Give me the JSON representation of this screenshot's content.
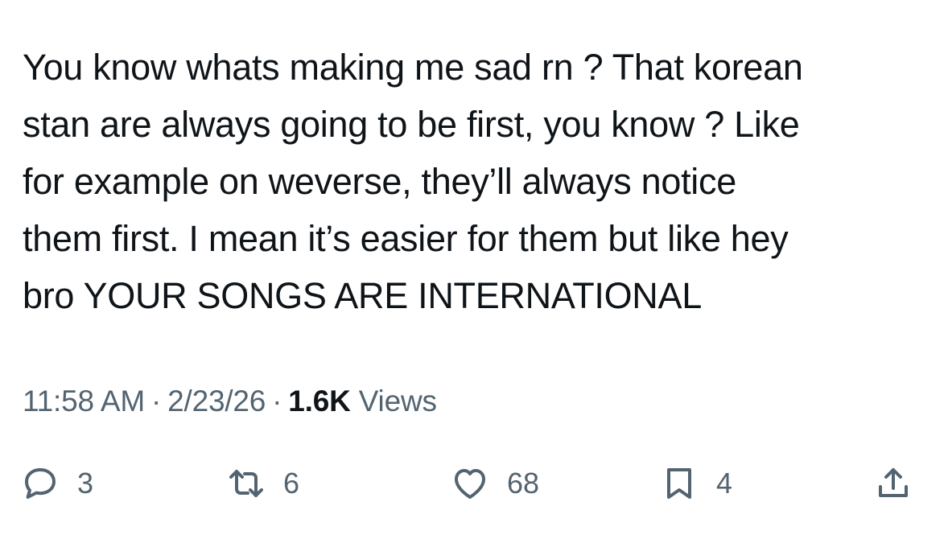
{
  "tweet": {
    "text_lines": [
      "You know whats making me sad rn ? That korean",
      "stan are always going to be first, you know ? Like",
      "for example on weverse, they’ll always notice",
      "them first. I mean it’s easier for them but like hey",
      "bro YOUR SONGS ARE INTERNATIONAL"
    ]
  },
  "meta": {
    "time": "11:58 AM",
    "separator": "·",
    "date": "2/23/26",
    "views_count": "1.6K",
    "views_label": "Views"
  },
  "actions": {
    "reply": {
      "icon": "reply-icon",
      "count": "3"
    },
    "retweet": {
      "icon": "retweet-icon",
      "count": "6"
    },
    "like": {
      "icon": "heart-icon",
      "count": "68"
    },
    "bookmark": {
      "icon": "bookmark-icon",
      "count": "4"
    },
    "share": {
      "icon": "share-icon"
    }
  },
  "colors": {
    "text": "#0f1419",
    "secondary": "#536471",
    "background": "#ffffff"
  }
}
